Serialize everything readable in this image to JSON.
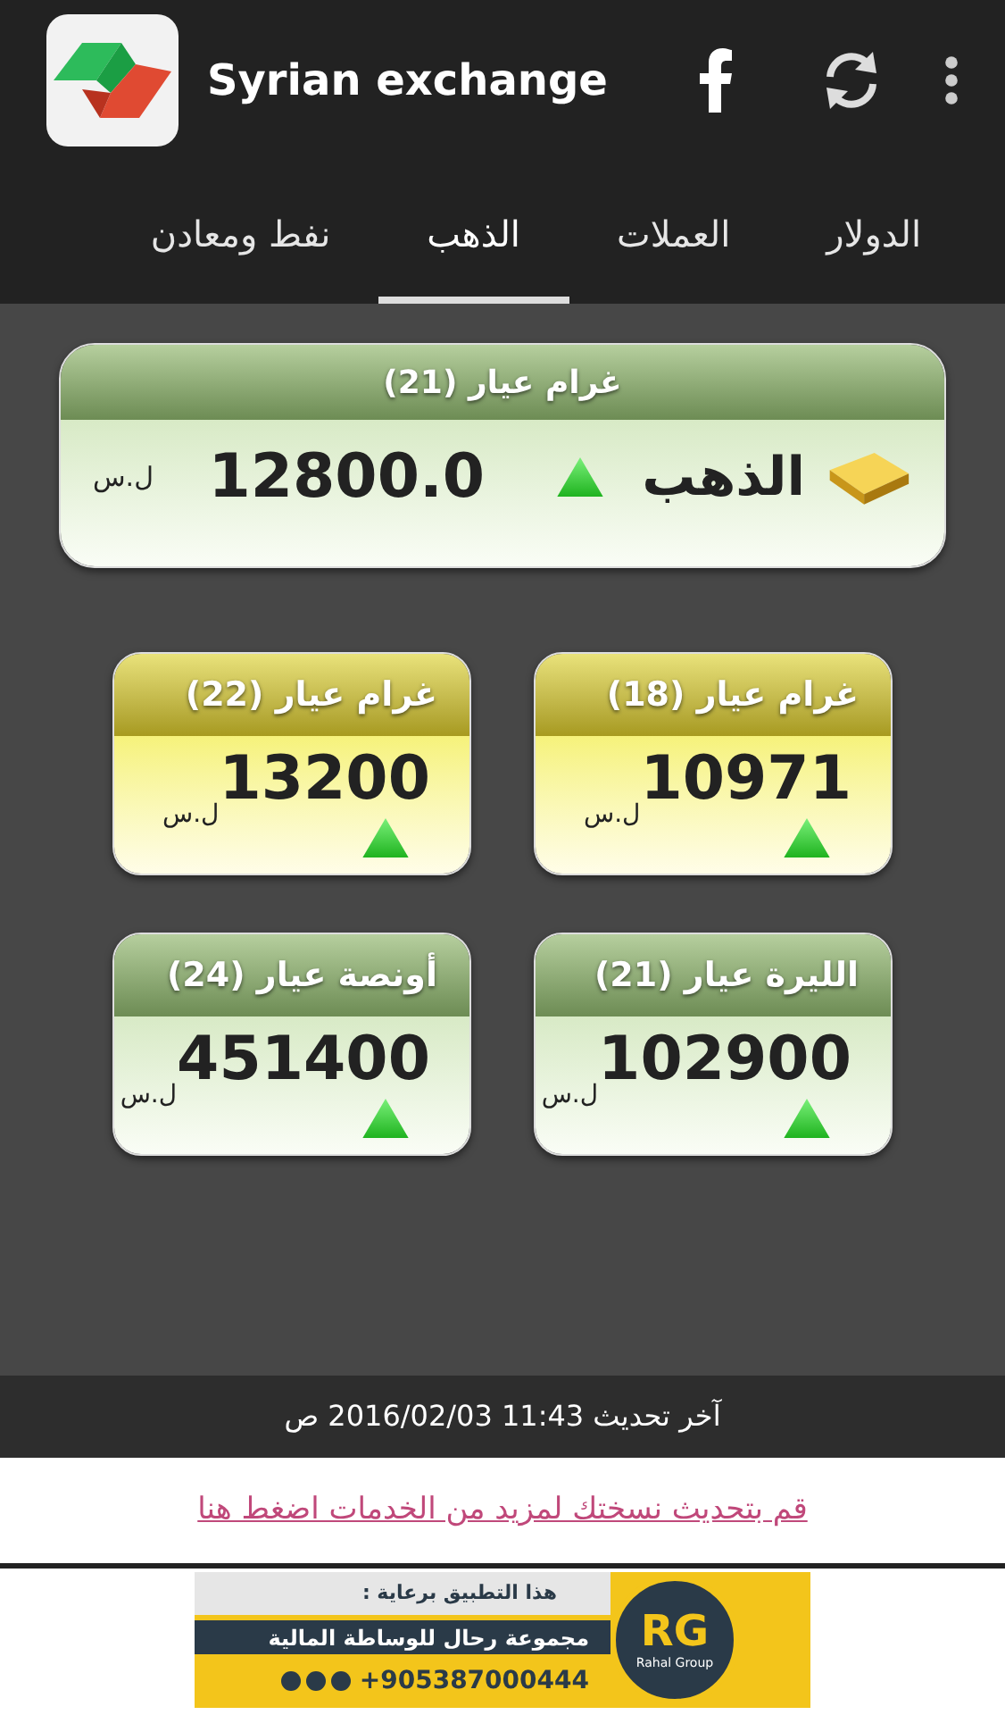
{
  "app_bar": {
    "title": "Syrian exchange"
  },
  "tabs": [
    {
      "label": "الدولار",
      "selected": false
    },
    {
      "label": "العملات",
      "selected": false
    },
    {
      "label": "الذهب",
      "selected": true
    },
    {
      "label": "نفط ومعادن",
      "selected": false
    }
  ],
  "main_card": {
    "title": "غرام عيار (21)",
    "label": "الذهب",
    "rising": true,
    "price": "12800.0",
    "currency": "ل.س"
  },
  "cards": [
    {
      "kind": "gold",
      "title": "غرام عيار (18)",
      "price": "10971",
      "currency": "ل.س",
      "rising": true
    },
    {
      "kind": "gold",
      "title": "غرام عيار (22)",
      "price": "13200",
      "currency": "ل.س",
      "rising": true
    },
    {
      "kind": "green",
      "title": "الليرة عيار (21)",
      "price": "102900",
      "currency": "ل.س",
      "rising": true
    },
    {
      "kind": "green",
      "title": "أونصة عيار (24)",
      "price": "451400",
      "currency": "ل.س",
      "rising": true
    }
  ],
  "last_update": "آخر تحديث 11:43 2016/02/03 ص",
  "update_link": "قم بتحديث نسختك لمزيد من الخدمات اضغط هنا",
  "banner": {
    "sponsor_line": "هذا التطبيق برعاية :",
    "company": "مجموعة رحال للوساطة المالية",
    "phone": "+905387000444",
    "logo_letters": "RG",
    "logo_caption": "Rahal Group"
  }
}
